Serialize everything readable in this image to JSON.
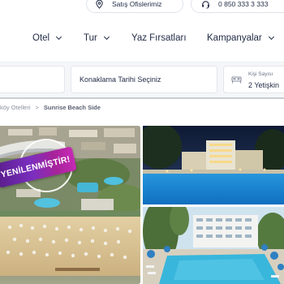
{
  "utility_bar": {
    "sales_offices_label": "Satış Ofislerimiz",
    "phone_number": "0 850 333 3 333"
  },
  "nav": {
    "items": [
      {
        "label": "Otel",
        "has_dropdown": true
      },
      {
        "label": "Tur",
        "has_dropdown": true
      },
      {
        "label": "Yaz Fırsatları",
        "has_dropdown": false
      },
      {
        "label": "Kampanyalar",
        "has_dropdown": true
      }
    ]
  },
  "search": {
    "date_placeholder": "Konaklama Tarihi Seçiniz",
    "guests_label": "Kişi Sayısı",
    "guests_value": "2 Yetişkin"
  },
  "breadcrumb": {
    "previous": "köy Otelleri",
    "separator": ">",
    "current": "Sunrise Beach Side"
  },
  "gallery": {
    "badge_text": "YENİLENMİŞTİR!",
    "colors": {
      "badge_start": "#5a1e8c",
      "badge_end": "#c62ab4",
      "pool": "#1e90d8",
      "sky_night": "#10203e"
    }
  }
}
